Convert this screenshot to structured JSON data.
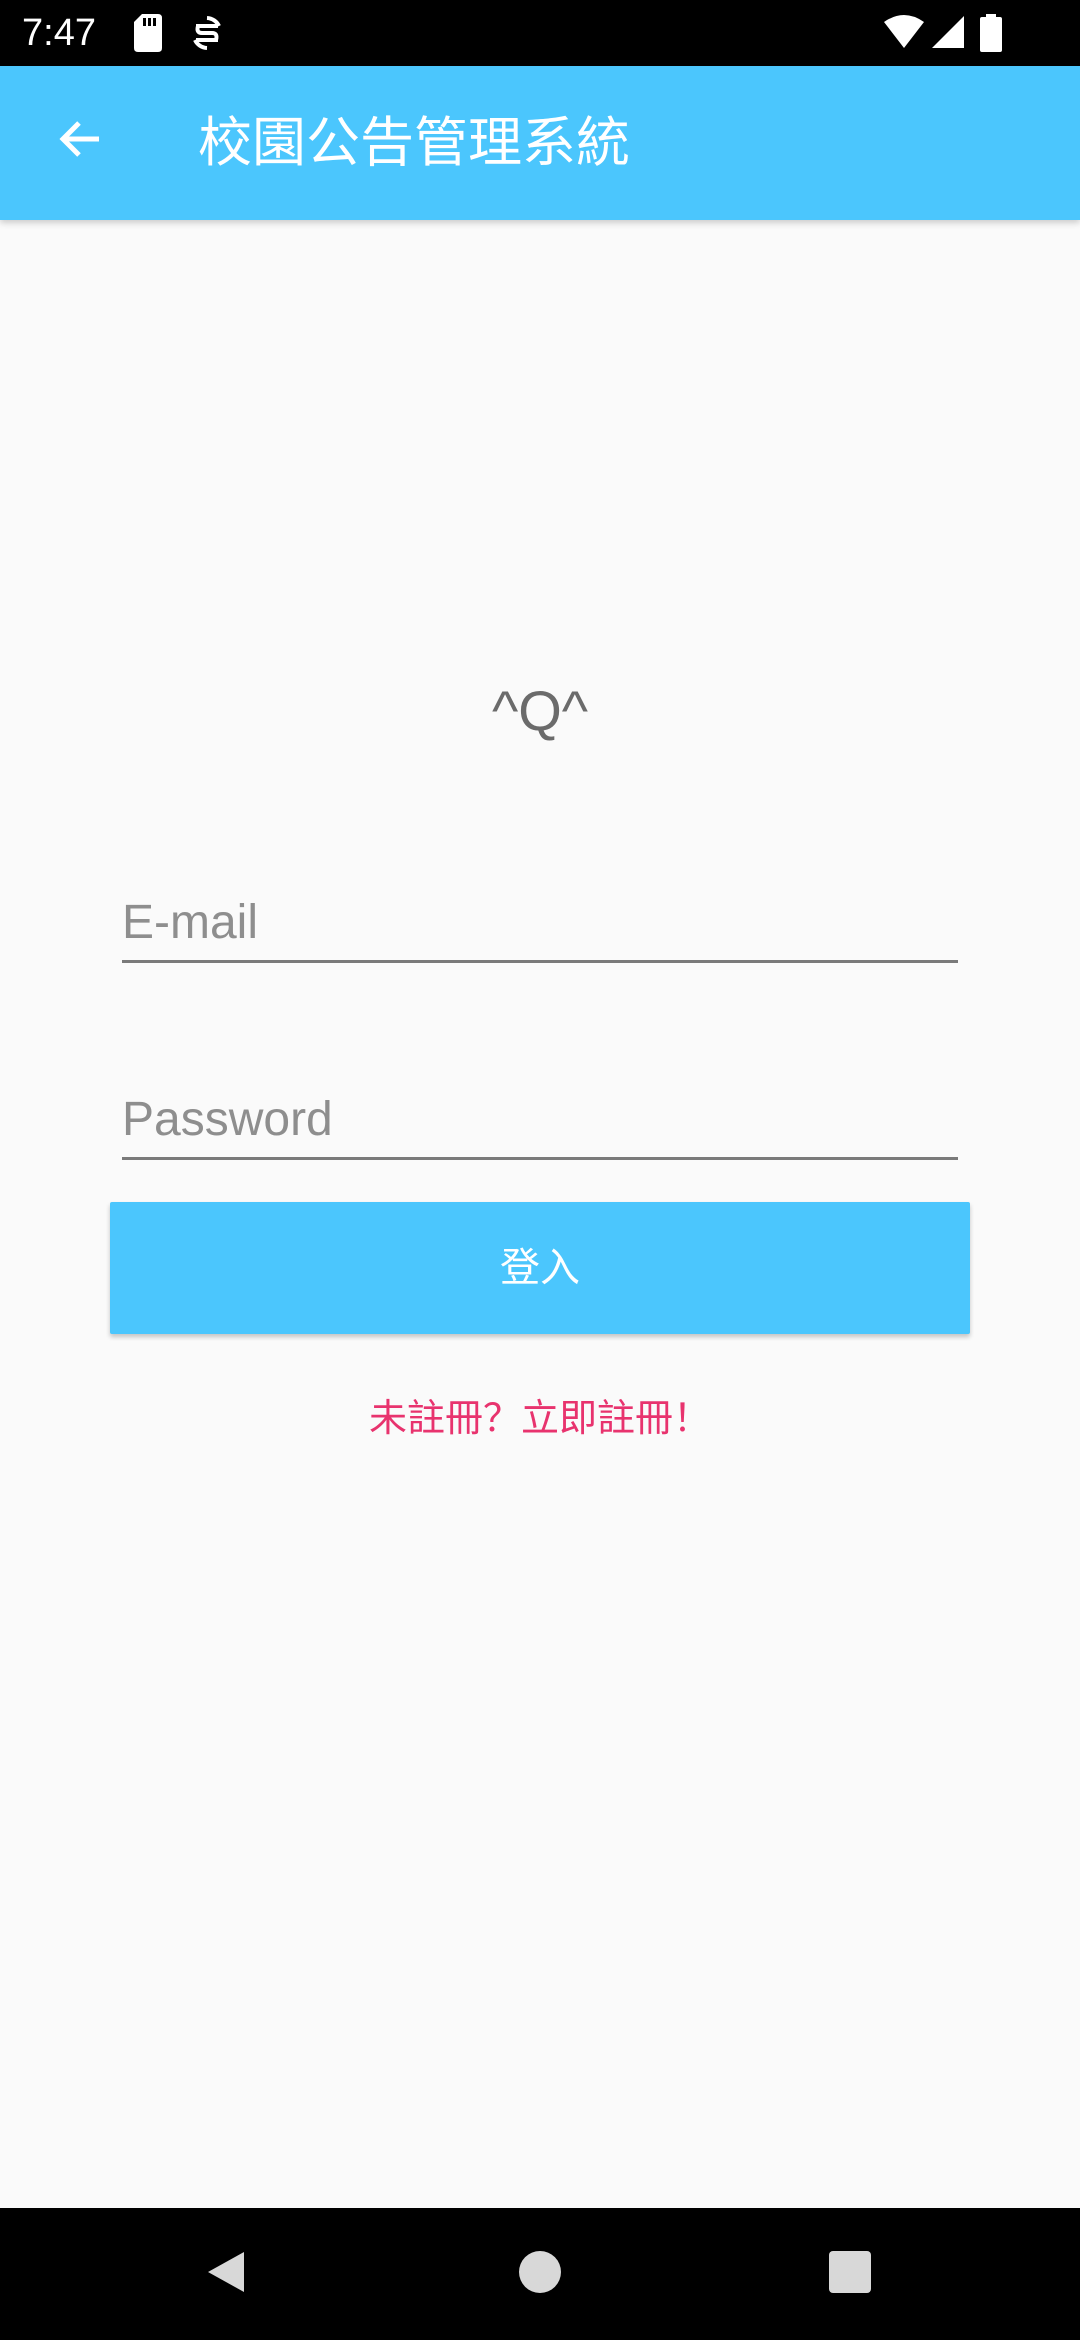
{
  "status_bar": {
    "time": "7:47",
    "icons": [
      "sd-card-icon",
      "sync-icon",
      "wifi-icon",
      "signal-icon",
      "battery-icon"
    ]
  },
  "app_bar": {
    "title": "校園公告管理系統",
    "back_icon": "arrow-back-icon",
    "color": "#4bc6fd"
  },
  "login": {
    "logo_text": "^Q^",
    "email_placeholder": "E-mail",
    "email_value": "",
    "password_placeholder": "Password",
    "password_value": "",
    "login_label": "登入",
    "register_label": "未註冊？立即註冊！",
    "accent_color": "#e8336e"
  },
  "nav_bar": {
    "back_icon": "nav-back-icon",
    "home_icon": "nav-home-icon",
    "recents_icon": "nav-recents-icon"
  }
}
